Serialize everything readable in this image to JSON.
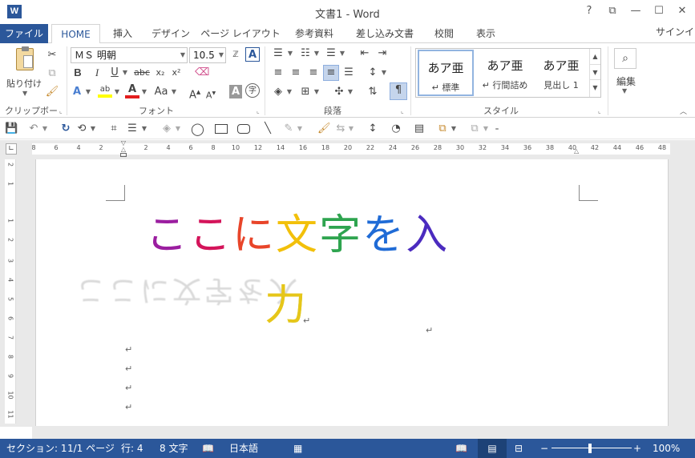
{
  "app": {
    "title": "文書1 - Word",
    "icon": "W"
  },
  "window": {
    "help": "?",
    "ribbon_display": "⧉",
    "minimize": "—",
    "maximize": "☐",
    "close": "✕"
  },
  "tabs": {
    "file": "ファイル",
    "items": [
      "HOME",
      "挿入",
      "デザイン",
      "ページ レイアウト",
      "参考資料",
      "差し込み文書",
      "校閲",
      "表示"
    ],
    "signin": "サインイン"
  },
  "ribbon": {
    "clipboard": {
      "paste": "貼り付け",
      "label": "クリップボード"
    },
    "font": {
      "name": "ＭＳ 明朝",
      "size": "10.5",
      "label": "フォント"
    },
    "paragraph": {
      "label": "段落"
    },
    "styles": {
      "label": "スタイル",
      "items": [
        {
          "sample": "あア亜",
          "name": "標準"
        },
        {
          "sample": "あア亜",
          "name": "行間詰め"
        },
        {
          "sample": "あア亜",
          "name": "見出し 1"
        }
      ]
    },
    "editing": {
      "label": "編集"
    }
  },
  "ruler": {
    "h_ticks": [
      "8",
      "6",
      "4",
      "2",
      "2",
      "4",
      "6",
      "8",
      "10",
      "12",
      "14",
      "16",
      "18",
      "20",
      "22",
      "24",
      "26",
      "28",
      "30",
      "32",
      "34",
      "36",
      "38",
      "40",
      "42",
      "44",
      "46",
      "48"
    ],
    "v_ticks": [
      "2",
      "1",
      "1",
      "2",
      "3",
      "4",
      "5",
      "6",
      "7",
      "8",
      "9",
      "10",
      "11"
    ]
  },
  "document": {
    "line1": [
      "こ",
      "こ",
      "に",
      "文",
      "字",
      "を",
      "入"
    ],
    "line2": "力",
    "line_colors": [
      "#9b1ea0",
      "#d4145a",
      "#e8452a",
      "#f2c00a",
      "#2ea44f",
      "#1f6bd6",
      "#4b2bbf"
    ],
    "line2_color": "#e6c619",
    "reflection": "ここに文字を入",
    "para_marks": [
      "↵",
      "↵",
      "↵",
      "↵",
      "↵",
      "↵"
    ]
  },
  "status": {
    "section": "セクション: 1",
    "page": "1/1 ページ",
    "row": "行: 4",
    "chars": "8 文字",
    "language": "日本語",
    "zoom": "100%"
  },
  "colors": {
    "accent": "#2b579a"
  }
}
